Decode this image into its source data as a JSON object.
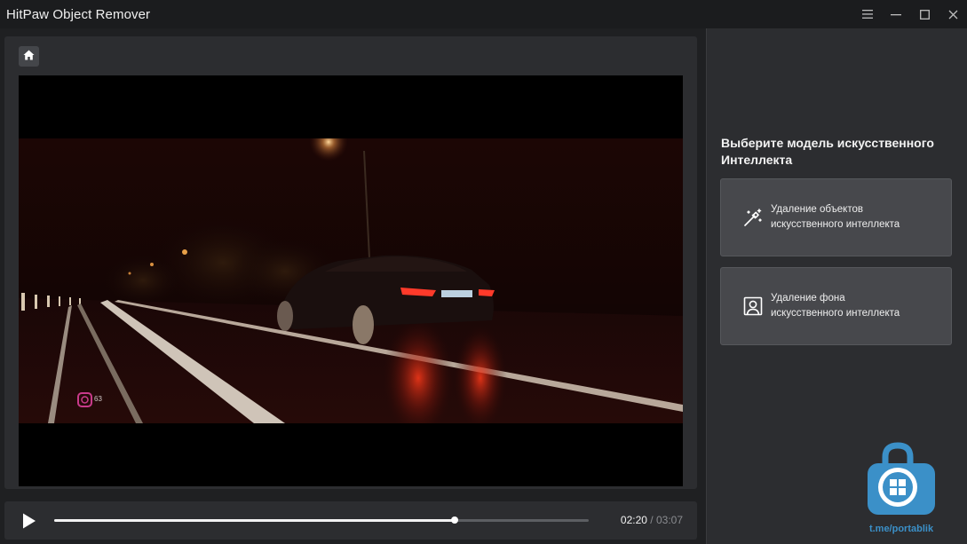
{
  "window": {
    "title": "HitPaw Object Remover",
    "controls": [
      "menu-icon",
      "minimize-icon",
      "maximize-icon",
      "close-icon"
    ]
  },
  "player": {
    "current_time": "02:20",
    "separator": "/",
    "total_time": "03:07",
    "progress": 0.749
  },
  "panel": {
    "title": "Выберите модель искусственного Интеллекта",
    "cards": [
      {
        "icon": "magic-wand-icon",
        "line1": "Удаление объектов",
        "line2": "искусственного интеллекта"
      },
      {
        "icon": "portrait-icon",
        "line1": "Удаление фона",
        "line2": "искусственного интеллекта"
      }
    ]
  },
  "video": {
    "overlay_tag": "63"
  },
  "watermark": {
    "text": "t.me/portablik",
    "color": "#3b90c8"
  },
  "colors": {
    "accent": "#ffffff",
    "panel_bg": "#2c2d30",
    "card_bg": "#47484c"
  }
}
